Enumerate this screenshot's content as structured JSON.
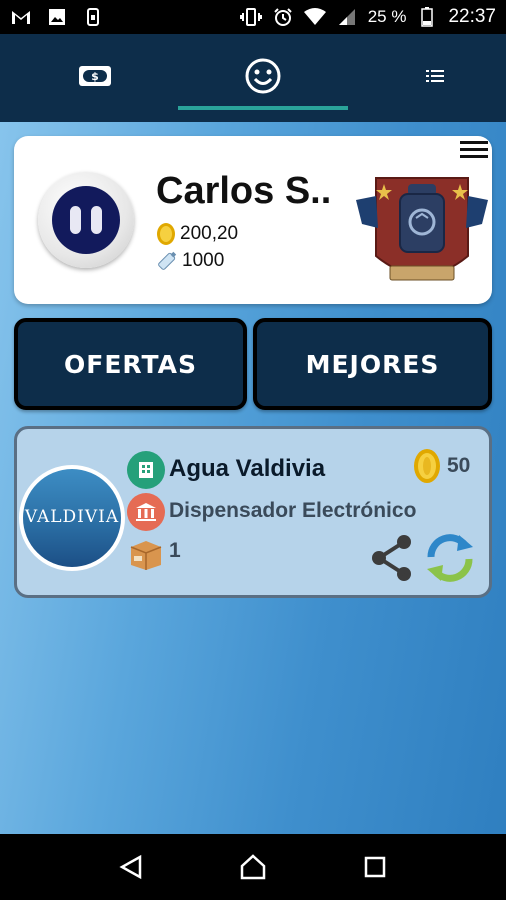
{
  "status_bar": {
    "icons_left": [
      "gmail-icon",
      "image-icon",
      "vpn-icon"
    ],
    "icons_right": [
      "vibrate-icon",
      "alarm-icon",
      "wifi-icon",
      "signal-icon"
    ],
    "battery": "25 %",
    "time": "22:37"
  },
  "tabs": [
    {
      "name": "money",
      "icon": "money-icon"
    },
    {
      "name": "profile",
      "icon": "smiley-icon",
      "active": true
    },
    {
      "name": "list",
      "icon": "list-icon"
    }
  ],
  "profile": {
    "name": "Carlos S..",
    "coins": "200,20",
    "bottles": "1000"
  },
  "buttons": {
    "ofertas": "OFERTAS",
    "mejores": "MEJORES"
  },
  "offer": {
    "logo_text": "VALDIVIA",
    "company": "Agua Valdivia",
    "type": "Dispensador Electrónico",
    "quantity": "1",
    "price": "50"
  },
  "colors": {
    "header": "#0d2d4a",
    "accent": "#2aa39a",
    "card": "#b6d3ea"
  }
}
